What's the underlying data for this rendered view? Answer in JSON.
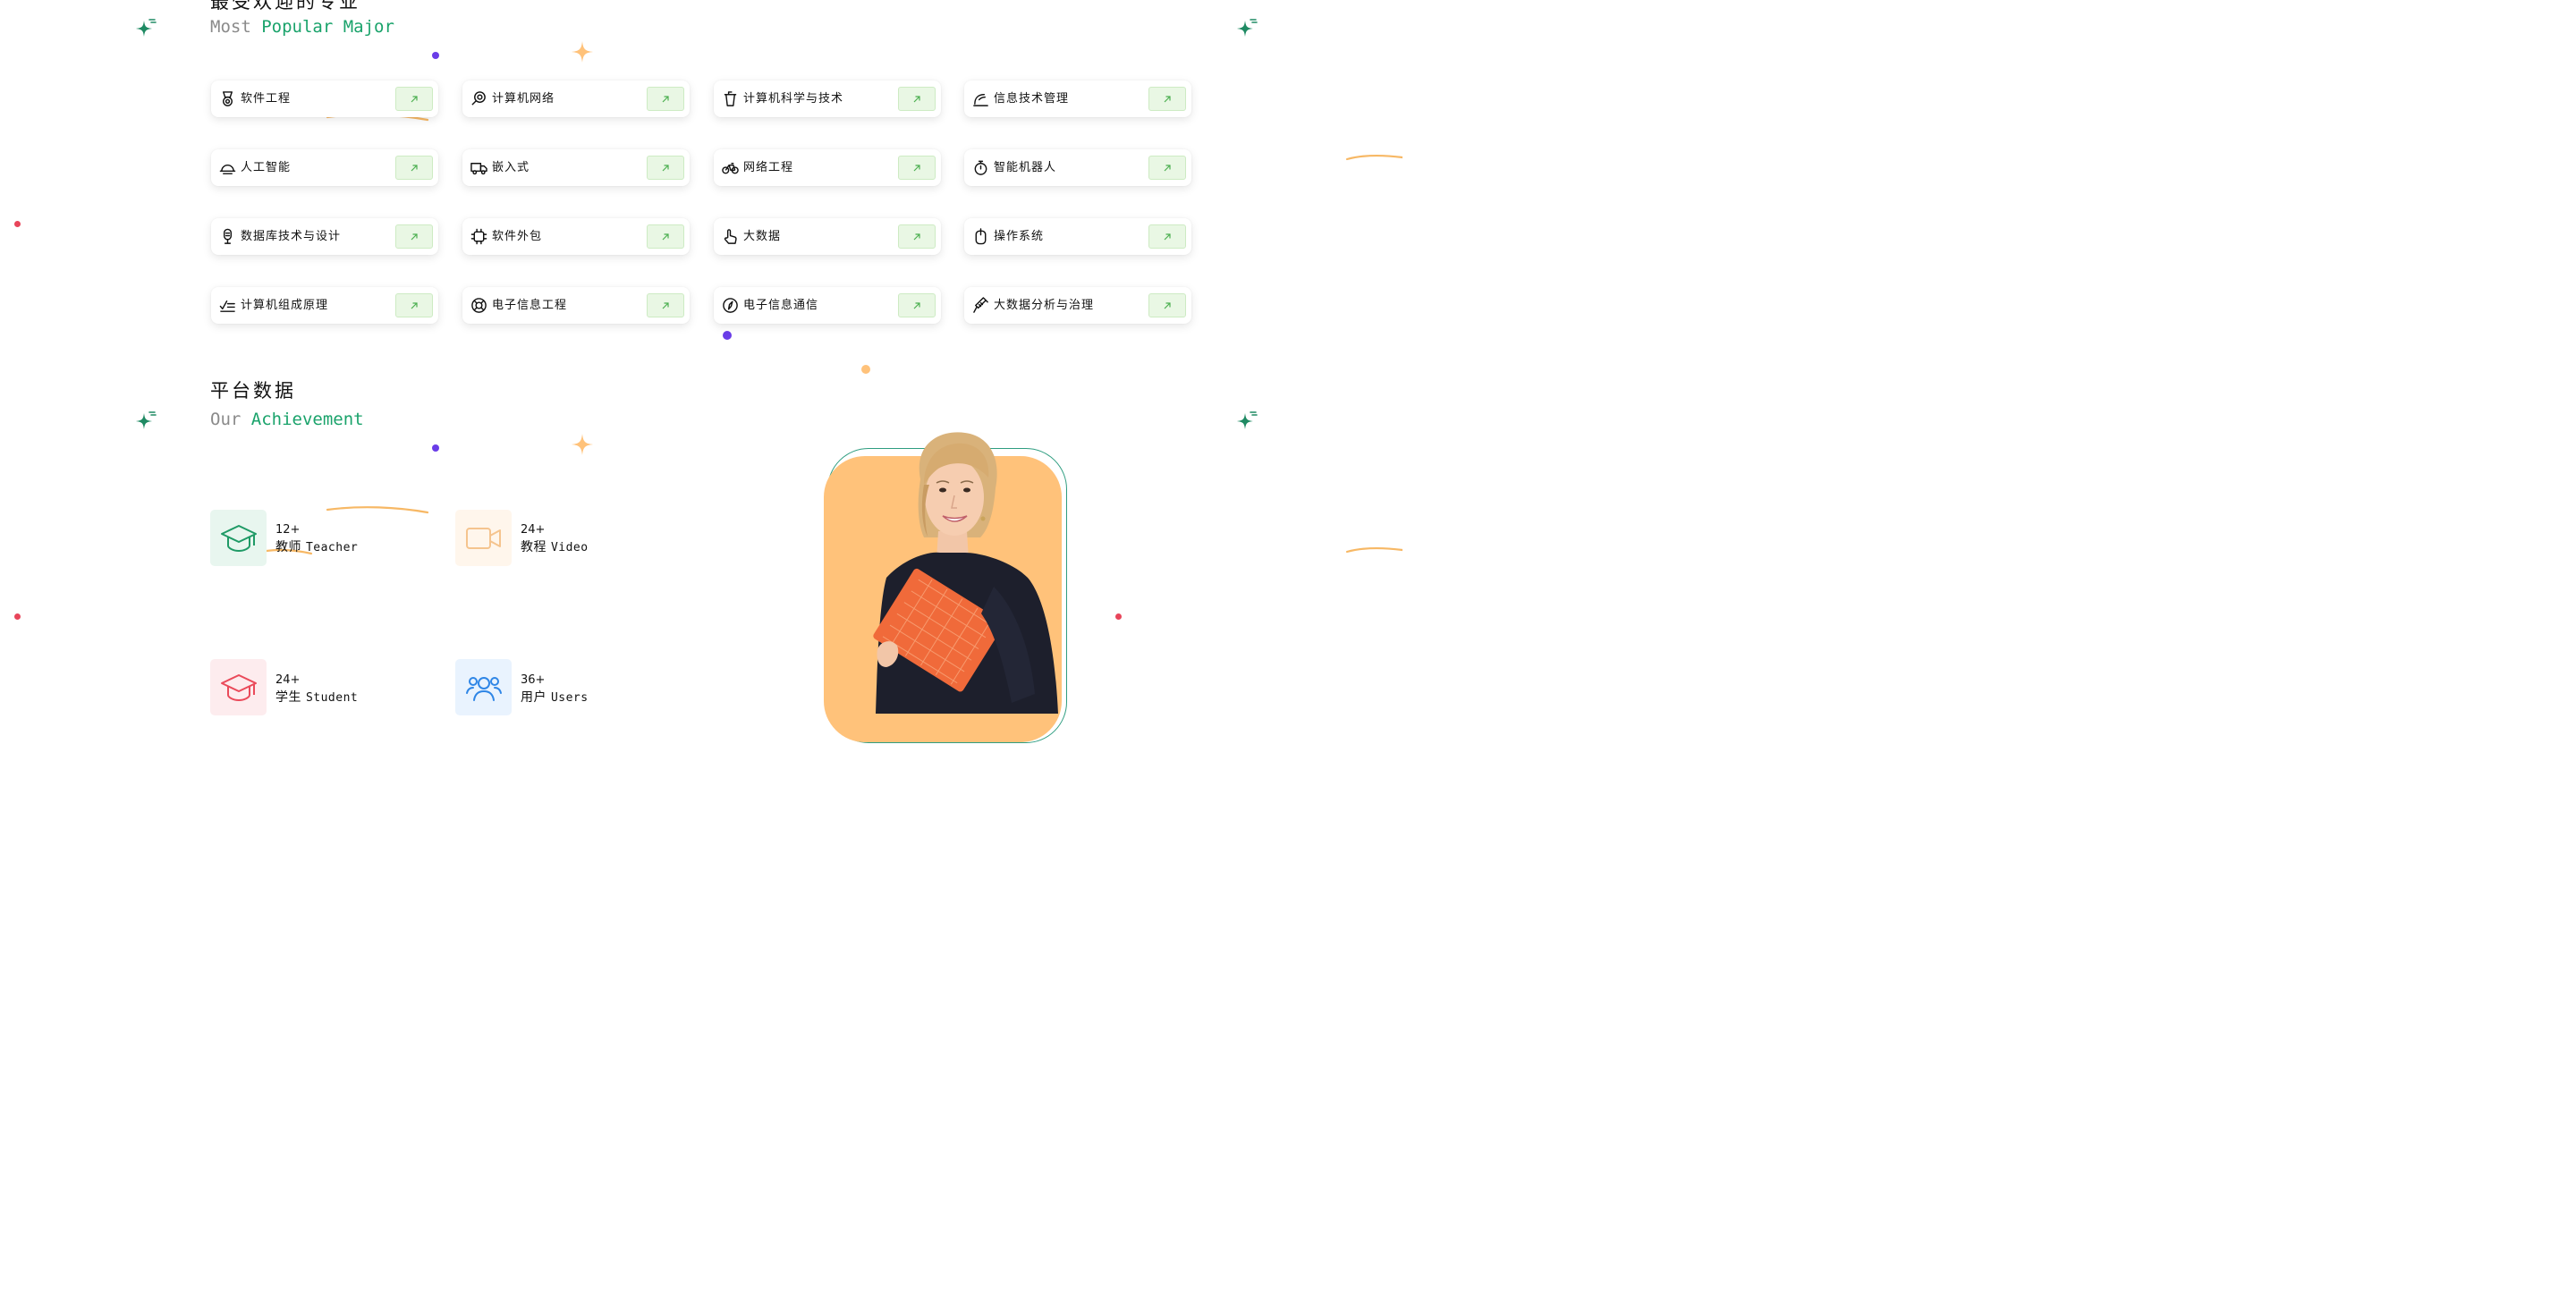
{
  "majors_section": {
    "title_cn": "最受欢迎的专业",
    "title_en_prefix": "Most ",
    "title_en_accent": "Popular Major"
  },
  "majors": [
    {
      "label": "软件工程",
      "icon": "medal-icon"
    },
    {
      "label": "计算机网络",
      "icon": "search-zoom-icon"
    },
    {
      "label": "计算机科学与技术",
      "icon": "cup-icon"
    },
    {
      "label": "信息技术管理",
      "icon": "wave-icon"
    },
    {
      "label": "人工智能",
      "icon": "dome-bell-icon"
    },
    {
      "label": "嵌入式",
      "icon": "truck-icon"
    },
    {
      "label": "网络工程",
      "icon": "bicycle-icon"
    },
    {
      "label": "智能机器人",
      "icon": "stopwatch-icon"
    },
    {
      "label": "数据库技术与设计",
      "icon": "microphone-icon"
    },
    {
      "label": "软件外包",
      "icon": "chip-icon"
    },
    {
      "label": "大数据",
      "icon": "pointer-hand-icon"
    },
    {
      "label": "操作系统",
      "icon": "mouse-icon"
    },
    {
      "label": "计算机组成原理",
      "icon": "checklist-icon"
    },
    {
      "label": "电子信息工程",
      "icon": "lifebuoy-icon"
    },
    {
      "label": "电子信息通信",
      "icon": "compass-icon"
    },
    {
      "label": "大数据分析与治理",
      "icon": "syringe-icon"
    }
  ],
  "stats_section": {
    "title_cn": "平台数据",
    "title_en_prefix": "Our ",
    "title_en_accent": "Achievement"
  },
  "stats": [
    {
      "number": "12+",
      "label_cn": "教师",
      "label_en": "Teacher",
      "icon": "graduation-cap-icon",
      "bg": "#e8f6ef",
      "color": "#1f9a66"
    },
    {
      "number": "24+",
      "label_cn": "教程",
      "label_en": "Video",
      "icon": "video-camera-icon",
      "bg": "#fff6ec",
      "color": "#f5c48e"
    },
    {
      "number": "24+",
      "label_cn": "学生",
      "label_en": "Student",
      "icon": "graduation-cap-icon",
      "bg": "#fdecee",
      "color": "#ea4a5a"
    },
    {
      "number": "36+",
      "label_cn": "用户",
      "label_en": "Users",
      "icon": "users-icon",
      "bg": "#e9f3fe",
      "color": "#2f86e6"
    }
  ],
  "colors": {
    "accent_green": "#1aa36b",
    "card_arrow_bg": "#e9f7e4",
    "orange": "#ffc27a",
    "sparkle_green": "#1f8a63",
    "dot_purple": "#6a3de8",
    "dot_red": "#e8455a"
  }
}
